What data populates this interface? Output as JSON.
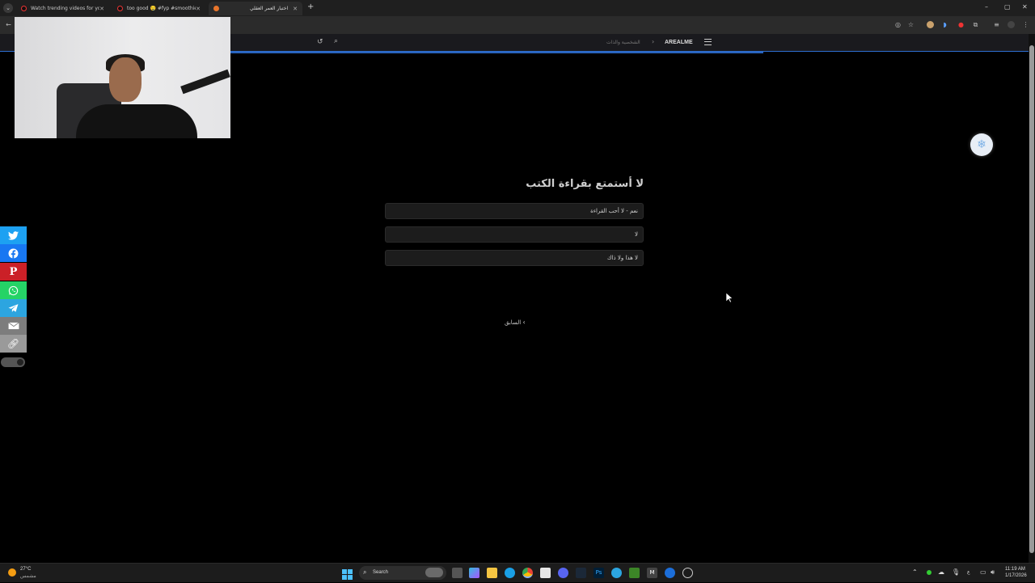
{
  "browser": {
    "tabs": [
      {
        "label": "Watch trending videos for you",
        "active": false
      },
      {
        "label": "too good 🤤 #fyp #smoothie",
        "active": false
      },
      {
        "label": "اختبار العمر العقلي",
        "active": true
      }
    ],
    "new_tab": "+",
    "window": {
      "minimize": "–",
      "maximize": "▢",
      "close": "✕"
    }
  },
  "site": {
    "brand": "AREALME",
    "breadcrumb": "الشخصية والذات",
    "separator": "›"
  },
  "quiz": {
    "question": "لا أستمتع بقراءة الكتب",
    "answers": [
      {
        "label": "نعم - لا أحب القراءة"
      },
      {
        "label": "لا"
      },
      {
        "label": "لا هذا ولا ذاك"
      }
    ],
    "previous": "السابق"
  },
  "share": {
    "items": [
      {
        "icon": "twitter-icon",
        "color": "#1da1f2"
      },
      {
        "icon": "facebook-icon",
        "color": "#1877f2"
      },
      {
        "icon": "pinterest-icon",
        "color": "#cb2027"
      },
      {
        "icon": "whatsapp-icon",
        "color": "#25d366"
      },
      {
        "icon": "telegram-icon",
        "color": "#2ca5e0"
      },
      {
        "icon": "email-icon",
        "color": "#7d7d7d"
      },
      {
        "icon": "link-icon",
        "color": "#9a9a9a"
      }
    ]
  },
  "taskbar": {
    "weather_temp": "27°C",
    "weather_desc": "مشمس",
    "search_label": "Search",
    "time": "11:19 AM",
    "date": "1/17/2026",
    "lang": "ع"
  }
}
